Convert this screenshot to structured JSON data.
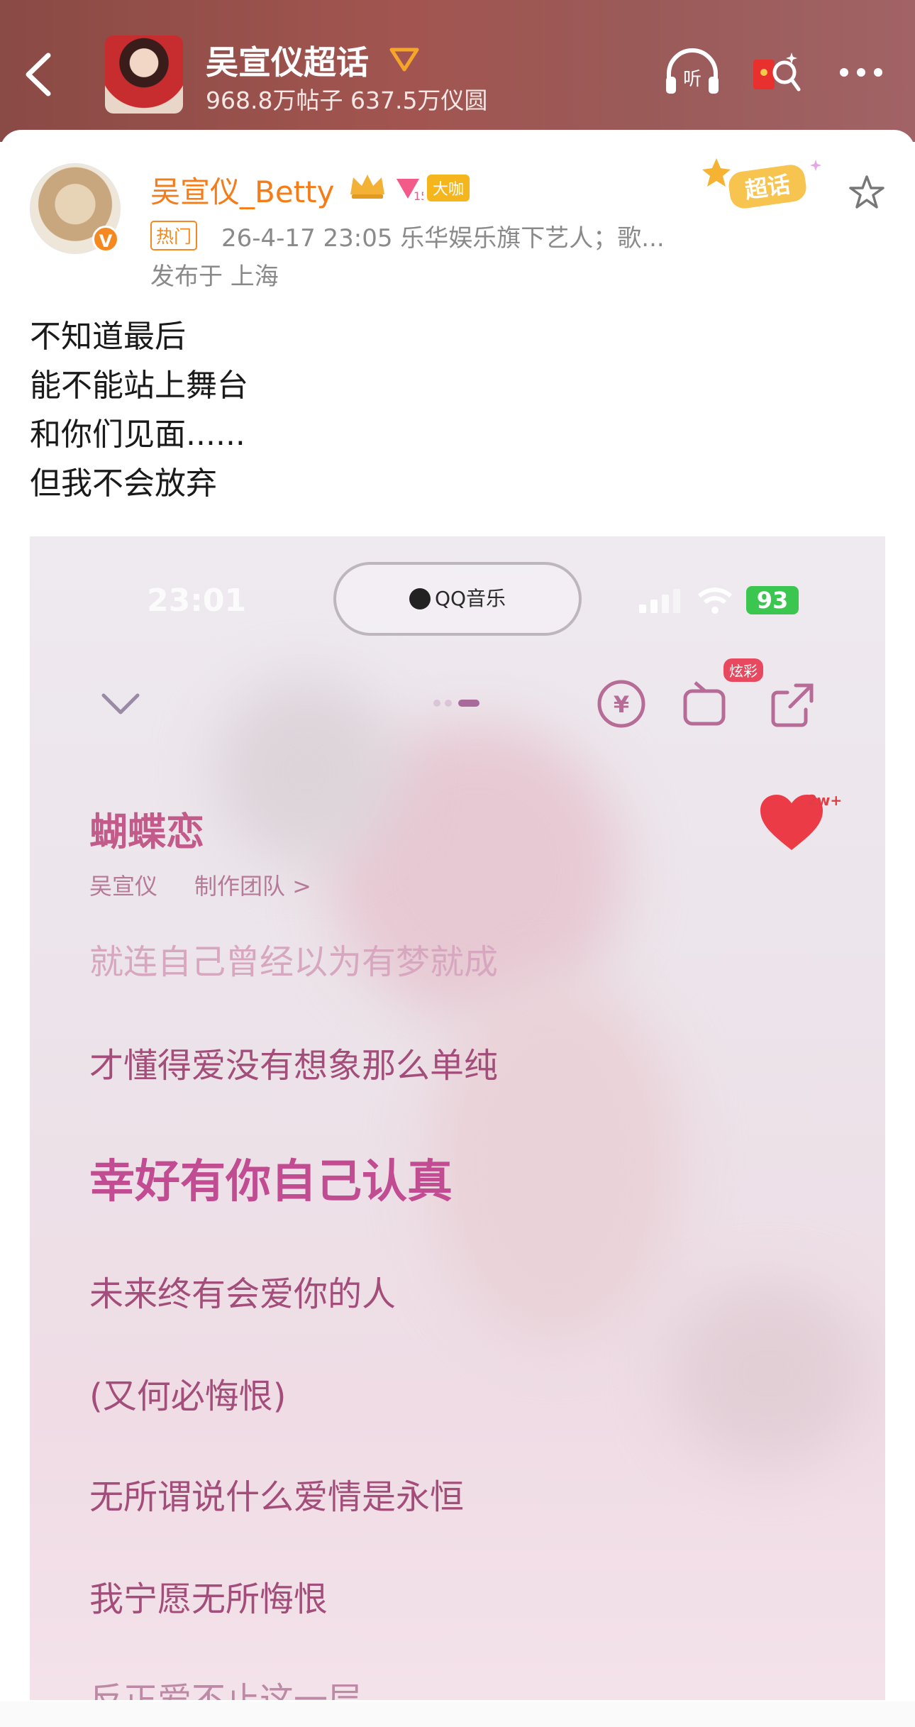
{
  "header": {
    "topic_title": "吴宣仪超话",
    "stats": "968.8万帖子 637.5万仪圆"
  },
  "post": {
    "username": "吴宣仪_Betty",
    "badge_daka": "大咖",
    "badge_hot": "热门",
    "meta": "26-4-17 23:05  乐华娱乐旗下艺人；歌...",
    "location": "发布于 上海",
    "verified_mark": "V",
    "chaohua_label": "超话",
    "text_lines": [
      "不知道最后",
      "能不能站上舞台",
      "和你们见面......",
      "但我不会放弃"
    ]
  },
  "screenshot": {
    "status_time": "23:01",
    "app_name": "QQ音乐",
    "battery": "93",
    "song_title": "蝴蝶恋",
    "artist": "吴宣仪",
    "credits": "制作团队 >",
    "like_count": "2w+",
    "xuancai": "炫彩",
    "yuan_icon": "¥",
    "lyrics": [
      "就连自己曾经以为有梦就成",
      "才懂得爱没有想象那么单纯",
      "幸好有你自己认真",
      "未来终有会爱你的人",
      "(又何必悔恨)",
      "无所谓说什么爱情是永恒",
      "我宁愿无所悔恨",
      "反正爱不止这一层"
    ]
  },
  "icons": {
    "back": "chevron-left-icon",
    "listen": "headphones-listen-icon",
    "redpacket": "red-packet-icon",
    "more": "more-dots-icon",
    "favorite": "star-icon"
  }
}
